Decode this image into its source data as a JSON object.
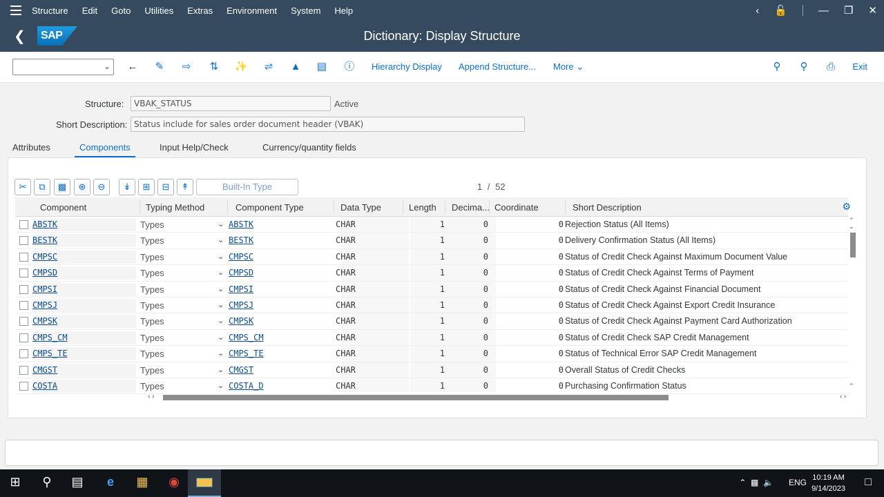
{
  "menu": {
    "items": [
      {
        "label": "Structure",
        "ul": ""
      },
      {
        "label": "Edit",
        "ul": "E"
      },
      {
        "label": "Goto",
        "ul": "G"
      },
      {
        "label": "Utilities",
        "ul": "U"
      },
      {
        "label": "Extras",
        "ul": "x"
      },
      {
        "label": "Environment",
        "ul": "n"
      },
      {
        "label": "System",
        "ul": "S"
      },
      {
        "label": "Help",
        "ul": "H"
      }
    ]
  },
  "header": {
    "logo_text": "SAP",
    "title": "Dictionary: Display Structure"
  },
  "toolbar": {
    "hierarchy_display": "Hierarchy Display",
    "append_structure": "Append Structure...",
    "more": "More",
    "exit": "Exit"
  },
  "form": {
    "structure_label": "Structure:",
    "structure_value": "VBAK_STATUS",
    "structure_status": "Active",
    "shortdesc_label": "Short Description:",
    "shortdesc_value": "Status include for sales order document header (VBAK)"
  },
  "tabs": [
    "Attributes",
    "Components",
    "Input Help/Check",
    "Currency/quantity fields"
  ],
  "active_tab": "Components",
  "table_toolbar": {
    "builtin_type": "Built-In Type",
    "pager_current": "1",
    "pager_sep": "/",
    "pager_total": "52"
  },
  "table": {
    "columns": [
      "Component",
      "Typing Method",
      "Component Type",
      "Data Type",
      "Length",
      "Decima...",
      "Coordinate",
      "Short Description"
    ],
    "rows": [
      {
        "component": "ABSTK",
        "typing": "Types",
        "ctype": "ABSTK",
        "dtype": "CHAR",
        "length": "1",
        "decimals": "0",
        "coord": "0",
        "desc": "Rejection Status (All Items)"
      },
      {
        "component": "BESTK",
        "typing": "Types",
        "ctype": "BESTK",
        "dtype": "CHAR",
        "length": "1",
        "decimals": "0",
        "coord": "0",
        "desc": "Delivery Confirmation Status (All Items)"
      },
      {
        "component": "CMPSC",
        "typing": "Types",
        "ctype": "CMPSC",
        "dtype": "CHAR",
        "length": "1",
        "decimals": "0",
        "coord": "0",
        "desc": "Status of Credit Check Against Maximum Document Value"
      },
      {
        "component": "CMPSD",
        "typing": "Types",
        "ctype": "CMPSD",
        "dtype": "CHAR",
        "length": "1",
        "decimals": "0",
        "coord": "0",
        "desc": "Status of Credit Check Against Terms of Payment"
      },
      {
        "component": "CMPSI",
        "typing": "Types",
        "ctype": "CMPSI",
        "dtype": "CHAR",
        "length": "1",
        "decimals": "0",
        "coord": "0",
        "desc": "Status of Credit Check Against Financial Document"
      },
      {
        "component": "CMPSJ",
        "typing": "Types",
        "ctype": "CMPSJ",
        "dtype": "CHAR",
        "length": "1",
        "decimals": "0",
        "coord": "0",
        "desc": "Status of Credit Check Against Export Credit Insurance"
      },
      {
        "component": "CMPSK",
        "typing": "Types",
        "ctype": "CMPSK",
        "dtype": "CHAR",
        "length": "1",
        "decimals": "0",
        "coord": "0",
        "desc": "Status of Credit Check Against Payment Card Authorization"
      },
      {
        "component": "CMPS_CM",
        "typing": "Types",
        "ctype": "CMPS_CM",
        "dtype": "CHAR",
        "length": "1",
        "decimals": "0",
        "coord": "0",
        "desc": "Status of Credit Check SAP Credit Management"
      },
      {
        "component": "CMPS_TE",
        "typing": "Types",
        "ctype": "CMPS_TE",
        "dtype": "CHAR",
        "length": "1",
        "decimals": "0",
        "coord": "0",
        "desc": "Status of Technical Error SAP Credit Management"
      },
      {
        "component": "CMGST",
        "typing": "Types",
        "ctype": "CMGST",
        "dtype": "CHAR",
        "length": "1",
        "decimals": "0",
        "coord": "0",
        "desc": "Overall Status of Credit Checks"
      },
      {
        "component": "COSTA",
        "typing": "Types",
        "ctype": "COSTA_D",
        "dtype": "CHAR",
        "length": "1",
        "decimals": "0",
        "coord": "0",
        "desc": "Purchasing Confirmation Status"
      }
    ]
  },
  "taskbar": {
    "lang": "ENG",
    "time": "10:19 AM",
    "date": "9/14/2023"
  },
  "colors": {
    "shell": "#354a5f",
    "accent": "#0a6ed1",
    "taskbar": "#101418"
  }
}
